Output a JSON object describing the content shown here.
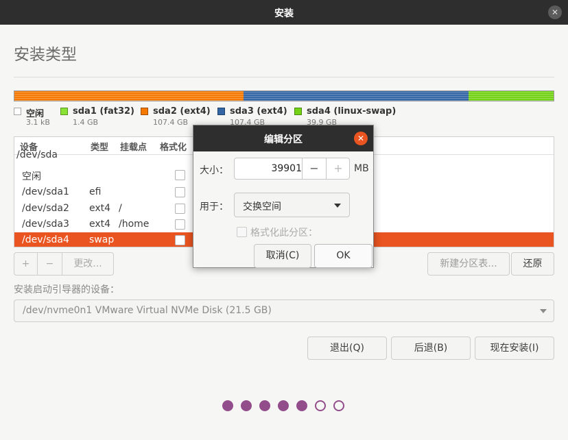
{
  "window": {
    "title": "安装"
  },
  "page": {
    "title": "安装类型"
  },
  "colors": {
    "accent": "#e95420",
    "free": "#ffffff",
    "fat32": "#8ae234",
    "ext4_home": "#f57900",
    "ext4_sda3": "#3465a4",
    "swap": "#73d216",
    "dot": "#924d8b"
  },
  "partition_bar": [
    {
      "name": "sda1",
      "fraction": 0.0001,
      "color": "#8ae234"
    },
    {
      "name": "sda2",
      "fraction": 0.425,
      "color": "#f57900"
    },
    {
      "name": "sda3",
      "fraction": 0.417,
      "color": "#3465a4"
    },
    {
      "name": "sda4",
      "fraction": 0.158,
      "color": "#73d216"
    }
  ],
  "legend": [
    {
      "label": "空闲",
      "size": "3.1 kB",
      "color": "#ffffff"
    },
    {
      "label": "sda1 (fat32)",
      "size": "1.4 GB",
      "color": "#8ae234"
    },
    {
      "label": "sda2 (ext4)",
      "size": "107.4 GB",
      "color": "#f57900"
    },
    {
      "label": "sda3 (ext4)",
      "size": "107.4 GB",
      "color": "#3465a4"
    },
    {
      "label": "sda4 (linux-swap)",
      "size": "39.9 GB",
      "color": "#73d216"
    }
  ],
  "table": {
    "headers": [
      "设备",
      "类型",
      "挂载点",
      "格式化"
    ],
    "rows": [
      {
        "device": "/dev/sda",
        "type": "",
        "mount": "",
        "checkbox": false
      },
      {
        "device": "空闲",
        "type": "",
        "mount": "",
        "checkbox": true
      },
      {
        "device": "/dev/sda1",
        "type": "efi",
        "mount": "",
        "checkbox": true
      },
      {
        "device": "/dev/sda2",
        "type": "ext4",
        "mount": "/",
        "checkbox": true
      },
      {
        "device": "/dev/sda3",
        "type": "ext4",
        "mount": "/home",
        "checkbox": true
      },
      {
        "device": "/dev/sda4",
        "type": "swap",
        "mount": "",
        "checkbox": true,
        "selected": true
      }
    ]
  },
  "toolbar": {
    "add": "+",
    "remove": "−",
    "change": "更改...",
    "new_table": "新建分区表...",
    "revert": "还原"
  },
  "boot": {
    "label": "安装启动引导器的设备：",
    "value": "/dev/nvme0n1 VMware Virtual NVMe Disk (21.5 GB)"
  },
  "actions": {
    "quit": "退出(Q)",
    "back": "后退(B)",
    "install": "现在安装(I)"
  },
  "progress": {
    "total": 7,
    "completed": 5
  },
  "dialog": {
    "title": "编辑分区",
    "size_label": "大小：",
    "size_value": "39901",
    "size_unit": "MB",
    "minus": "−",
    "plus": "+",
    "use_label": "用于：",
    "use_value": "交换空间",
    "format_label": "格式化此分区：",
    "cancel": "取消(C)",
    "ok": "OK"
  }
}
